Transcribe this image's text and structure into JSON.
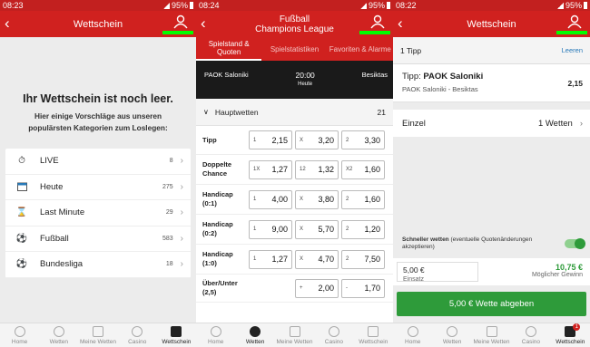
{
  "panel1": {
    "status": {
      "time": "08:23",
      "battery": "95%"
    },
    "header": {
      "title": "Wettschein"
    },
    "empty": {
      "title": "Ihr Wettschein ist noch leer.",
      "subtitle": "Hier einige Vorschläge aus unseren populärsten Kategorien zum Loslegen:"
    },
    "categories": [
      {
        "label": "LIVE",
        "count": "8",
        "icon": "stopwatch-icon"
      },
      {
        "label": "Heute",
        "count": "275",
        "icon": "calendar-icon"
      },
      {
        "label": "Last Minute",
        "count": "29",
        "icon": "hourglass-icon"
      },
      {
        "label": "Fußball",
        "count": "583",
        "icon": "soccer-ball-icon"
      },
      {
        "label": "Bundesliga",
        "count": "18",
        "icon": "soccer-ball-icon"
      }
    ]
  },
  "panel2": {
    "status": {
      "time": "08:24",
      "battery": "95%"
    },
    "header": {
      "title1": "Fußball",
      "title2": "Champions League"
    },
    "tabs": [
      "Spielstand & Quoten",
      "Spielstatistiken",
      "Favoriten & Alarme"
    ],
    "match": {
      "home": "PAOK Saloniki",
      "time": "20:00",
      "day": "Heute",
      "away": "Besiktas"
    },
    "section": {
      "label": "Hauptwetten",
      "count": "21"
    },
    "markets": [
      {
        "label": "Tipp",
        "odds": [
          {
            "l": "1",
            "v": "2,15"
          },
          {
            "l": "X",
            "v": "3,20"
          },
          {
            "l": "2",
            "v": "3,30"
          }
        ]
      },
      {
        "label": "Doppelte Chance",
        "odds": [
          {
            "l": "1X",
            "v": "1,27"
          },
          {
            "l": "12",
            "v": "1,32"
          },
          {
            "l": "X2",
            "v": "1,60"
          }
        ]
      },
      {
        "label": "Handicap (0:1)",
        "odds": [
          {
            "l": "1",
            "v": "4,00"
          },
          {
            "l": "X",
            "v": "3,80"
          },
          {
            "l": "2",
            "v": "1,60"
          }
        ]
      },
      {
        "label": "Handicap (0:2)",
        "odds": [
          {
            "l": "1",
            "v": "9,00"
          },
          {
            "l": "X",
            "v": "5,70"
          },
          {
            "l": "2",
            "v": "1,20"
          }
        ]
      },
      {
        "label": "Handicap (1:0)",
        "odds": [
          {
            "l": "1",
            "v": "1,27"
          },
          {
            "l": "X",
            "v": "4,70"
          },
          {
            "l": "2",
            "v": "7,50"
          }
        ]
      },
      {
        "label": "Über/Unter (2,5)",
        "odds": [
          {
            "l": "+",
            "v": "2,00"
          },
          {
            "l": "-",
            "v": "1,70"
          }
        ]
      }
    ]
  },
  "panel3": {
    "status": {
      "time": "08:22",
      "battery": "95%"
    },
    "header": {
      "title": "Wettschein"
    },
    "tip_count": "1 Tipp",
    "clear": "Leeren",
    "tip": {
      "prefix": "Tipp: ",
      "pick": "PAOK Saloniki",
      "match": "PAOK Saloniki - Besiktas",
      "odds": "2,15"
    },
    "mode": {
      "label": "Einzel",
      "value": "1 Wetten"
    },
    "quick": {
      "bold": "Schneller wetten",
      "rest": " (eventuelle Quotenänderungen akzeptieren)"
    },
    "stake": {
      "value": "5,00 €",
      "label": "Einsatz"
    },
    "win": {
      "value": "10,75 €",
      "label": "Möglicher Gewinn"
    },
    "place": "5,00 € Wette abgeben"
  },
  "nav": [
    "Home",
    "Wetten",
    "Meine Wetten",
    "Casino",
    "Wettschein"
  ],
  "nav_badge": "1",
  "colors": {
    "brand": "#d0211f",
    "green": "#2e9b3a",
    "highlight": "#00ff00"
  }
}
